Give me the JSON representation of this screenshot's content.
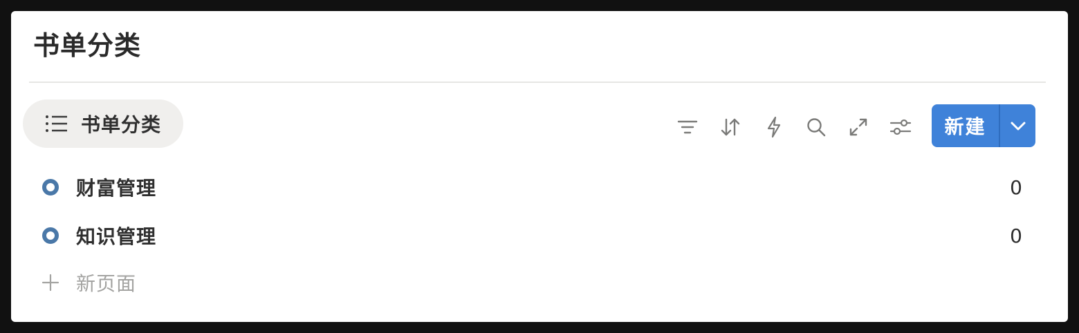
{
  "page": {
    "title": "书单分类"
  },
  "view_tab": {
    "label": "书单分类",
    "icon": "list-icon"
  },
  "toolbar": {
    "icons": [
      "filter-icon",
      "sort-icon",
      "automation-icon",
      "search-icon",
      "expand-icon",
      "settings-icon"
    ],
    "new_label": "新建",
    "dropdown_icon": "chevron-down-icon"
  },
  "rows": [
    {
      "title": "财富管理",
      "count": "0",
      "icon": "category-icon"
    },
    {
      "title": "知识管理",
      "count": "0",
      "icon": "category-icon"
    }
  ],
  "new_page": {
    "label": "新页面",
    "icon": "plus-icon"
  },
  "colors": {
    "accent": "#3f82d9",
    "category_icon": "#4a78a8",
    "muted": "#a3a3a1"
  }
}
